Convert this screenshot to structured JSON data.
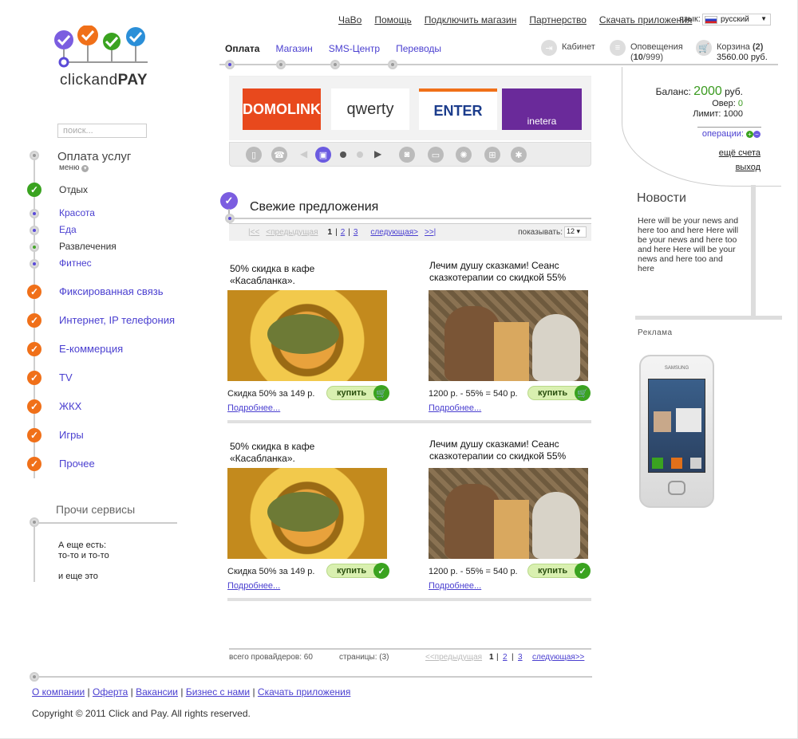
{
  "top_links": [
    "ЧаВо",
    "Помощь",
    "Подключить магазин",
    "Партнерство",
    "Скачать приложения"
  ],
  "lang": {
    "label": "язык:",
    "value": "русский"
  },
  "logo": {
    "bold": "PAY",
    "thin": "clickand"
  },
  "tabs": [
    {
      "label": "Оплата"
    },
    {
      "label": "Магазин"
    },
    {
      "label": "SMS-Центр"
    },
    {
      "label": "Переводы"
    }
  ],
  "header_right": {
    "cabinet": "Кабинет",
    "notifications_label": "Оповещения",
    "notifications_count": "10",
    "notifications_total": "/999)",
    "notifications_open": "(",
    "cart_label": "Корзина",
    "cart_count": "(2)",
    "cart_sum": "3560.00 руб."
  },
  "banners": [
    "DOMOLINK",
    "qwerty",
    "ENTER",
    "inetera"
  ],
  "balance": {
    "label": "Баланс:",
    "amount": "2000",
    "currency": "руб.",
    "over_label": "Овер:",
    "over": "0",
    "limit_label": "Лимит:",
    "limit": "1000",
    "ops": "операции:",
    "more_accounts": "ещё счета",
    "logout": "выход"
  },
  "search": {
    "placeholder": "поиск..."
  },
  "sidebar": {
    "title": "Оплата услуг",
    "menu": "меню",
    "items": [
      {
        "label": "Отдых"
      },
      {
        "label": "Красота"
      },
      {
        "label": "Еда"
      },
      {
        "label": "Развлечения"
      },
      {
        "label": "Фитнес"
      },
      {
        "label": "Фиксированная связь"
      },
      {
        "label": "Интернет, IP телефония"
      },
      {
        "label": "Е-коммерция"
      },
      {
        "label": "TV"
      },
      {
        "label": "ЖКХ"
      },
      {
        "label": "Игры"
      },
      {
        "label": "Прочее"
      }
    ],
    "other_title": "Прочи сервисы",
    "other_text_1": "А еще есть:",
    "other_text_2": "то-то и то-то",
    "other_text_3": "и еще это"
  },
  "offers_section": {
    "title": "Свежие предложения",
    "first": "|<<",
    "prev": "<предыдущая",
    "pages": [
      "1",
      "2",
      "3"
    ],
    "next": "следующая>",
    "last": ">>|",
    "show_label": "показывать:",
    "show_value": "12"
  },
  "offers": [
    {
      "title": "50% скидка в кафе «Касабланка».",
      "price": "Скидка 50% за 149 р.",
      "buy": "купить",
      "more": "Подробнее..."
    },
    {
      "title": "Лечим душу сказками! Сеанс сказкотерапии со скидкой 55%",
      "price": "1200 р. - 55% = 540 р.",
      "buy": "купить",
      "more": "Подробнее..."
    },
    {
      "title": "50% скидка в кафе «Касабланка».",
      "price": "Скидка 50% за 149 р.",
      "buy": "купить",
      "more": "Подробнее..."
    },
    {
      "title": "Лечим душу сказками! Сеанс сказкотерапии со скидкой 55%",
      "price": "1200 р. - 55% = 540 р.",
      "buy": "купить",
      "more": "Подробнее..."
    }
  ],
  "bottom_pager": {
    "total": "всего провайдеров: 60",
    "pages": "страницы: (3)",
    "prev": "<<предыдущая",
    "p1": "1",
    "p2": "2",
    "p3": "3",
    "next": "следующая>>"
  },
  "news": {
    "title": "Новости",
    "body": "Here will be your news and here too and here Here will be your news and here too and here Here will be your news and here too and here"
  },
  "ads": {
    "title": "Реклама",
    "phone_brand": "SAMSUNG"
  },
  "footer": {
    "links": [
      "О компании",
      "Оферта",
      "Вакансии",
      "Бизнес с нами",
      "Скачать приложения"
    ],
    "copyright": "Copyright © 2011 Click and Pay. All rights reserved."
  },
  "colors": {
    "accent": "#4a3fd0",
    "green": "#3aa320",
    "orange": "#f07019"
  }
}
